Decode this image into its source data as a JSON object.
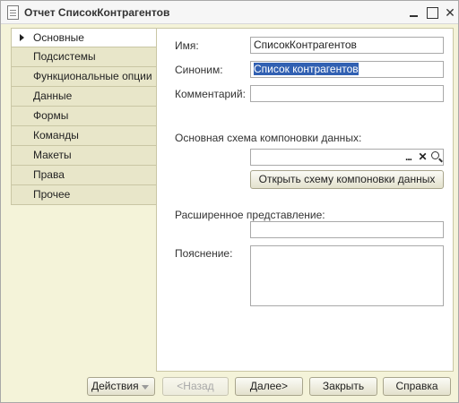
{
  "window": {
    "title": "Отчет СписокКонтрагентов",
    "icon": "report-document-icon",
    "controls": [
      "minimize-icon",
      "maximize-icon",
      "close-icon"
    ]
  },
  "tabs": [
    {
      "label": "Основные",
      "active": true
    },
    {
      "label": "Подсистемы",
      "active": false
    },
    {
      "label": "Функциональные опции",
      "active": false
    },
    {
      "label": "Данные",
      "active": false
    },
    {
      "label": "Формы",
      "active": false
    },
    {
      "label": "Команды",
      "active": false
    },
    {
      "label": "Макеты",
      "active": false
    },
    {
      "label": "Права",
      "active": false
    },
    {
      "label": "Прочее",
      "active": false
    }
  ],
  "form": {
    "name_label": "Имя:",
    "name_value": "СписокКонтрагентов",
    "synonym_label": "Синоним:",
    "synonym_value": "Список контрагентов",
    "comment_label": "Комментарий:",
    "comment_value": "",
    "schema_label": "Основная схема компоновки данных:",
    "schema_value": "",
    "schema_choose": "...",
    "schema_clear": "✕",
    "open_schema_button": "Открыть схему компоновки данных",
    "extended_label": "Расширенное представление:",
    "extended_value": "",
    "explanation_label": "Пояснение:",
    "explanation_value": ""
  },
  "footer": {
    "actions": "Действия",
    "back": "<Назад",
    "next": "Далее>",
    "close": "Закрыть",
    "help": "Справка"
  },
  "colors": {
    "window_bg": "#f4f3d9",
    "selection": "#3160b2"
  }
}
